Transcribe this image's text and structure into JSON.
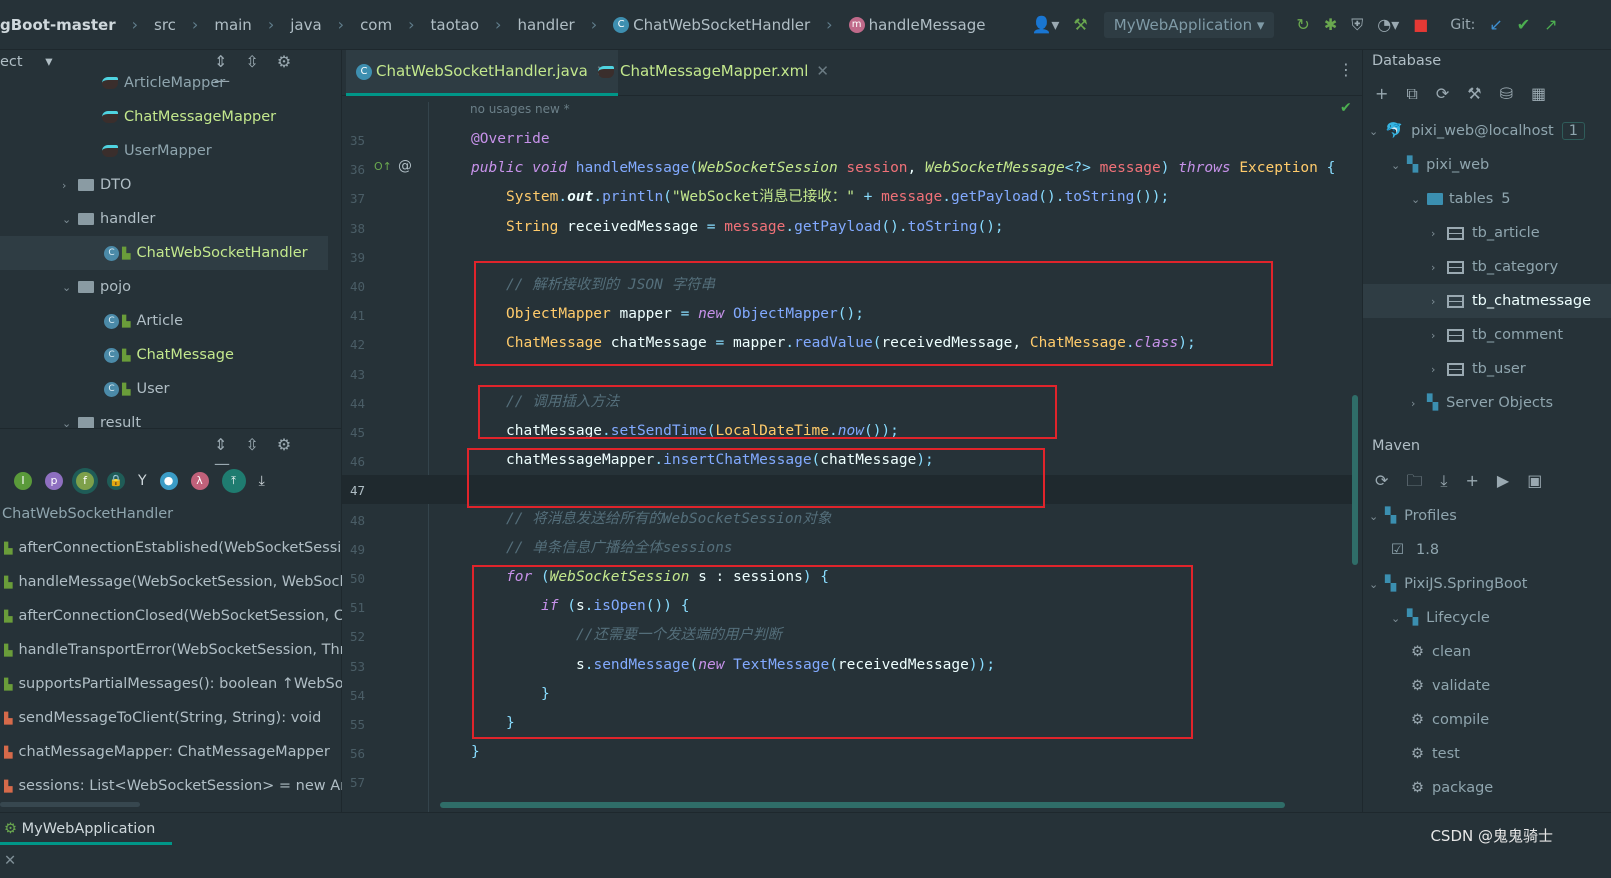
{
  "breadcrumb": [
    "gBoot-master",
    "src",
    "main",
    "java",
    "com",
    "taotao",
    "handler",
    "ChatWebSocketHandler",
    "handleMessage"
  ],
  "toolbar": {
    "run_config": "MyWebApplication",
    "git_label": "Git:"
  },
  "project": {
    "dropdown": "ect",
    "items": [
      {
        "label": "ArticleMapper",
        "type": "mapper",
        "level": 3
      },
      {
        "label": "ChatMessageMapper",
        "type": "mapper",
        "level": 3,
        "modified": true
      },
      {
        "label": "UserMapper",
        "type": "mapper",
        "level": 3
      },
      {
        "label": "DTO",
        "type": "folder",
        "level": 2,
        "expanded": false
      },
      {
        "label": "handler",
        "type": "folder",
        "level": 2,
        "expanded": true
      },
      {
        "label": "ChatWebSocketHandler",
        "type": "class",
        "level": 3,
        "modified": true,
        "selected": true
      },
      {
        "label": "pojo",
        "type": "folder",
        "level": 2,
        "expanded": true
      },
      {
        "label": "Article",
        "type": "class",
        "level": 3
      },
      {
        "label": "ChatMessage",
        "type": "class",
        "level": 3,
        "modified": true
      },
      {
        "label": "User",
        "type": "class",
        "level": 3
      },
      {
        "label": "result",
        "type": "folder",
        "level": 2,
        "expanded": true
      }
    ]
  },
  "structure": {
    "root": "ChatWebSocketHandler",
    "items": [
      {
        "label": "afterConnectionEstablished(WebSocketSession): v",
        "access": "public"
      },
      {
        "label": "handleMessage(WebSocketSession, WebSocketM",
        "access": "public"
      },
      {
        "label": "afterConnectionClosed(WebSocketSession, CloseS",
        "access": "public"
      },
      {
        "label": "handleTransportError(WebSocketSession, Throwal",
        "access": "public"
      },
      {
        "label": "supportsPartialMessages(): boolean ↑WebSocketH",
        "access": "public"
      },
      {
        "label": "sendMessageToClient(String, String): void",
        "access": "private"
      },
      {
        "label": "chatMessageMapper: ChatMessageMapper",
        "access": "private"
      },
      {
        "label": "sessions: List<WebSocketSession> = new ArrayLis",
        "access": "private"
      }
    ]
  },
  "editor": {
    "tabs": [
      {
        "label": "ChatWebSocketHandler.java",
        "active": true
      },
      {
        "label": "ChatMessageMapper.xml",
        "active": false
      }
    ],
    "hint": "no usages   new *",
    "lines": [
      {
        "n": "35",
        "i": 0,
        "t": [
          [
            "@Override",
            "an"
          ]
        ]
      },
      {
        "n": "36",
        "i": 0,
        "t": [
          [
            "public void ",
            "kw"
          ],
          [
            "handleMessage",
            "fn"
          ],
          [
            "(",
            "op"
          ],
          [
            "WebSocketSession",
            "tyi"
          ],
          [
            " session",
            "var"
          ],
          [
            ", ",
            "pl"
          ],
          [
            "WebSocketMessage",
            "tyi"
          ],
          [
            "<?>",
            "op"
          ],
          [
            " message",
            "var"
          ],
          [
            ")",
            "op"
          ],
          [
            " throws ",
            "kw"
          ],
          [
            "Exception",
            "ty"
          ],
          [
            " {",
            "op"
          ]
        ]
      },
      {
        "n": "37",
        "i": 1,
        "t": [
          [
            "System",
            "ty"
          ],
          [
            ".",
            "op"
          ],
          [
            "out",
            "bi"
          ],
          [
            ".",
            "op"
          ],
          [
            "println",
            "fn"
          ],
          [
            "(",
            "op"
          ],
          [
            "\"WebSocket消息已接收：\"",
            "str"
          ],
          [
            " + ",
            "op"
          ],
          [
            "message",
            "var"
          ],
          [
            ".",
            "op"
          ],
          [
            "getPayload",
            "fn"
          ],
          [
            "().",
            "op"
          ],
          [
            "toString",
            "fn"
          ],
          [
            "());",
            "op"
          ]
        ]
      },
      {
        "n": "38",
        "i": 1,
        "t": [
          [
            "String",
            "ty"
          ],
          [
            " receivedMessage ",
            "pl"
          ],
          [
            "= ",
            "op"
          ],
          [
            "message",
            "var"
          ],
          [
            ".",
            "op"
          ],
          [
            "getPayload",
            "fn"
          ],
          [
            "().",
            "op"
          ],
          [
            "toString",
            "fn"
          ],
          [
            "();",
            "op"
          ]
        ]
      },
      {
        "n": "39",
        "i": 1,
        "t": []
      },
      {
        "n": "40",
        "i": 1,
        "t": [
          [
            "// 解析接收到的 JSON 字符串",
            "cm"
          ]
        ]
      },
      {
        "n": "41",
        "i": 1,
        "t": [
          [
            "ObjectMapper",
            "ty"
          ],
          [
            " mapper ",
            "pl"
          ],
          [
            "= ",
            "op"
          ],
          [
            "new ",
            "kw"
          ],
          [
            "ObjectMapper",
            "fn"
          ],
          [
            "();",
            "op"
          ]
        ]
      },
      {
        "n": "42",
        "i": 1,
        "t": [
          [
            "ChatMessage",
            "ty"
          ],
          [
            " chatMessage ",
            "pl"
          ],
          [
            "= ",
            "op"
          ],
          [
            "mapper",
            "pl"
          ],
          [
            ".",
            "op"
          ],
          [
            "readValue",
            "fn"
          ],
          [
            "(",
            "op"
          ],
          [
            "receivedMessage, ",
            "pl"
          ],
          [
            "ChatMessage",
            "ty"
          ],
          [
            ".",
            "op"
          ],
          [
            "class",
            "kw"
          ],
          [
            ");",
            "op"
          ]
        ]
      },
      {
        "n": "43",
        "i": 1,
        "t": []
      },
      {
        "n": "44",
        "i": 1,
        "t": [
          [
            "// 调用插入方法",
            "cm"
          ]
        ]
      },
      {
        "n": "45",
        "i": 1,
        "t": [
          [
            "chatMessage",
            "pl"
          ],
          [
            ".",
            "op"
          ],
          [
            "setSendTime",
            "fn"
          ],
          [
            "(",
            "op"
          ],
          [
            "LocalDateTime",
            "ty"
          ],
          [
            ".",
            "op"
          ],
          [
            "now",
            "fni"
          ],
          [
            "());",
            "op"
          ]
        ]
      },
      {
        "n": "46",
        "i": 1,
        "t": [
          [
            "chatMessageMapper",
            "pl"
          ],
          [
            ".",
            "op"
          ],
          [
            "insertChatMessage",
            "fn"
          ],
          [
            "(",
            "op"
          ],
          [
            "chatMessage",
            "pl"
          ],
          [
            ");",
            "op"
          ]
        ]
      },
      {
        "n": "47",
        "i": 1,
        "t": [],
        "current": true
      },
      {
        "n": "48",
        "i": 1,
        "t": [
          [
            "// 将消息发送给所有的WebSocketSession对象",
            "cm"
          ]
        ]
      },
      {
        "n": "49",
        "i": 1,
        "t": [
          [
            "// 单条信息广播给全体sessions",
            "cm"
          ]
        ]
      },
      {
        "n": "50",
        "i": 1,
        "t": [
          [
            "for ",
            "kw"
          ],
          [
            "(",
            "op"
          ],
          [
            "WebSocketSession",
            "tyi"
          ],
          [
            " s : sessions",
            "pl"
          ],
          [
            ") {",
            "op"
          ]
        ]
      },
      {
        "n": "51",
        "i": 2,
        "t": [
          [
            "if ",
            "kw"
          ],
          [
            "(",
            "op"
          ],
          [
            "s",
            "pl"
          ],
          [
            ".",
            "op"
          ],
          [
            "isOpen",
            "fn"
          ],
          [
            "()) {",
            "op"
          ]
        ]
      },
      {
        "n": "52",
        "i": 3,
        "t": [
          [
            "//还需要一个发送端的用户判断",
            "cm"
          ]
        ]
      },
      {
        "n": "53",
        "i": 3,
        "t": [
          [
            "s",
            "pl"
          ],
          [
            ".",
            "op"
          ],
          [
            "sendMessage",
            "fn"
          ],
          [
            "(",
            "op"
          ],
          [
            "new ",
            "kw"
          ],
          [
            "TextMessage",
            "fn"
          ],
          [
            "(",
            "op"
          ],
          [
            "receivedMessage",
            "pl"
          ],
          [
            "));",
            "op"
          ]
        ]
      },
      {
        "n": "54",
        "i": 2,
        "t": [
          [
            "}",
            "op"
          ]
        ]
      },
      {
        "n": "55",
        "i": 1,
        "t": [
          [
            "}",
            "op"
          ]
        ]
      },
      {
        "n": "56",
        "i": 0,
        "t": [
          [
            "}",
            "op"
          ]
        ]
      },
      {
        "n": "57",
        "i": 0,
        "t": []
      }
    ]
  },
  "database": {
    "title": "Database",
    "items": [
      {
        "label": "pixi_web@localhost",
        "level": 0,
        "icon": "mysql-icon",
        "badge": "1"
      },
      {
        "label": "pixi_web",
        "level": 1,
        "icon": "schema-icon"
      },
      {
        "label": "tables",
        "count": "5",
        "level": 2,
        "icon": "folder-icon"
      },
      {
        "label": "tb_article",
        "level": 3,
        "icon": "table-icon"
      },
      {
        "label": "tb_category",
        "level": 3,
        "icon": "table-icon"
      },
      {
        "label": "tb_chatmessage",
        "level": 3,
        "icon": "table-icon",
        "selected": true
      },
      {
        "label": "tb_comment",
        "level": 3,
        "icon": "table-icon"
      },
      {
        "label": "tb_user",
        "level": 3,
        "icon": "table-icon"
      },
      {
        "label": "Server Objects",
        "level": 2,
        "icon": "server-objects-icon"
      }
    ]
  },
  "maven": {
    "title": "Maven",
    "items": [
      {
        "label": "Profiles",
        "level": 0,
        "icon": "profiles-icon"
      },
      {
        "label": "1.8",
        "level": 1,
        "icon": "checkbox-icon"
      },
      {
        "label": "PixiJS.SpringBoot",
        "level": 0,
        "icon": "maven-project-icon"
      },
      {
        "label": "Lifecycle",
        "level": 1,
        "icon": "lifecycle-icon"
      },
      {
        "label": "clean",
        "level": 2,
        "icon": "gear-icon"
      },
      {
        "label": "validate",
        "level": 2,
        "icon": "gear-icon"
      },
      {
        "label": "compile",
        "level": 2,
        "icon": "gear-icon"
      },
      {
        "label": "test",
        "level": 2,
        "icon": "gear-icon"
      },
      {
        "label": "package",
        "level": 2,
        "icon": "gear-icon"
      }
    ]
  },
  "bottom": {
    "run_tab": "MyWebApplication",
    "watermark": "CSDN @鬼鬼骑士"
  },
  "colors": {
    "accent": "#009688",
    "highlight_box": "#e0242b",
    "background": "#263238"
  }
}
